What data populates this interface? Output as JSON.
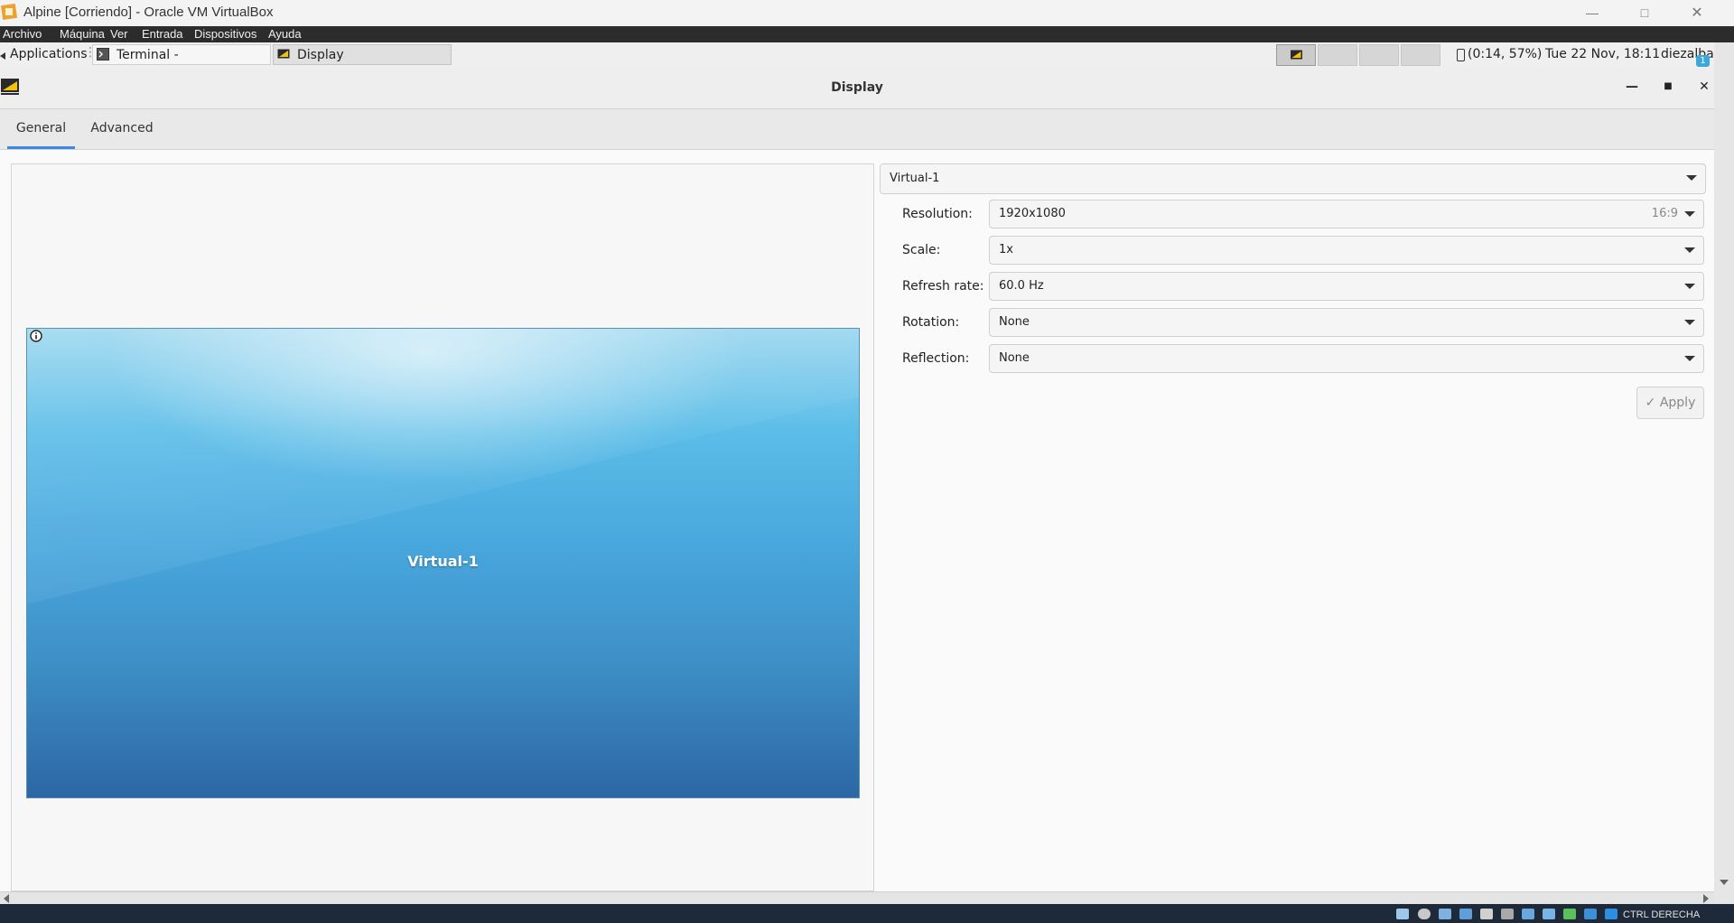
{
  "host": {
    "window_title": "Alpine [Corriendo] - Oracle VM VirtualBox",
    "menu": [
      "Archivo",
      "Máquina",
      "Ver",
      "Entrada",
      "Dispositivos",
      "Ayuda"
    ],
    "host_key_label": "CTRL DERECHA"
  },
  "panel": {
    "applications_label": "Applications",
    "tasks": [
      {
        "label": "Terminal -",
        "active": false
      },
      {
        "label": "Display",
        "active": true
      }
    ],
    "battery": "(0:14, 57%)",
    "clock": "Tue 22 Nov, 18:11",
    "user": "diezalba",
    "notification_count": "1"
  },
  "dialog": {
    "title": "Display",
    "tabs": [
      {
        "label": "General",
        "active": true
      },
      {
        "label": "Advanced",
        "active": false
      }
    ],
    "monitor_label": "Virtual-1",
    "output_select": "Virtual-1",
    "fields": [
      {
        "label": "Resolution:",
        "value": "1920x1080",
        "aspect": "16:9"
      },
      {
        "label": "Scale:",
        "value": "1x"
      },
      {
        "label": "Refresh rate:",
        "value": "60.0 Hz"
      },
      {
        "label": "Rotation:",
        "value": "None"
      },
      {
        "label": "Reflection:",
        "value": "None"
      }
    ],
    "apply_label": "Apply",
    "apply_enabled": false
  },
  "colors": {
    "accent": "#3d89e0",
    "monitor_top": "#9ed8ef",
    "monitor_bottom": "#2c66a5"
  }
}
